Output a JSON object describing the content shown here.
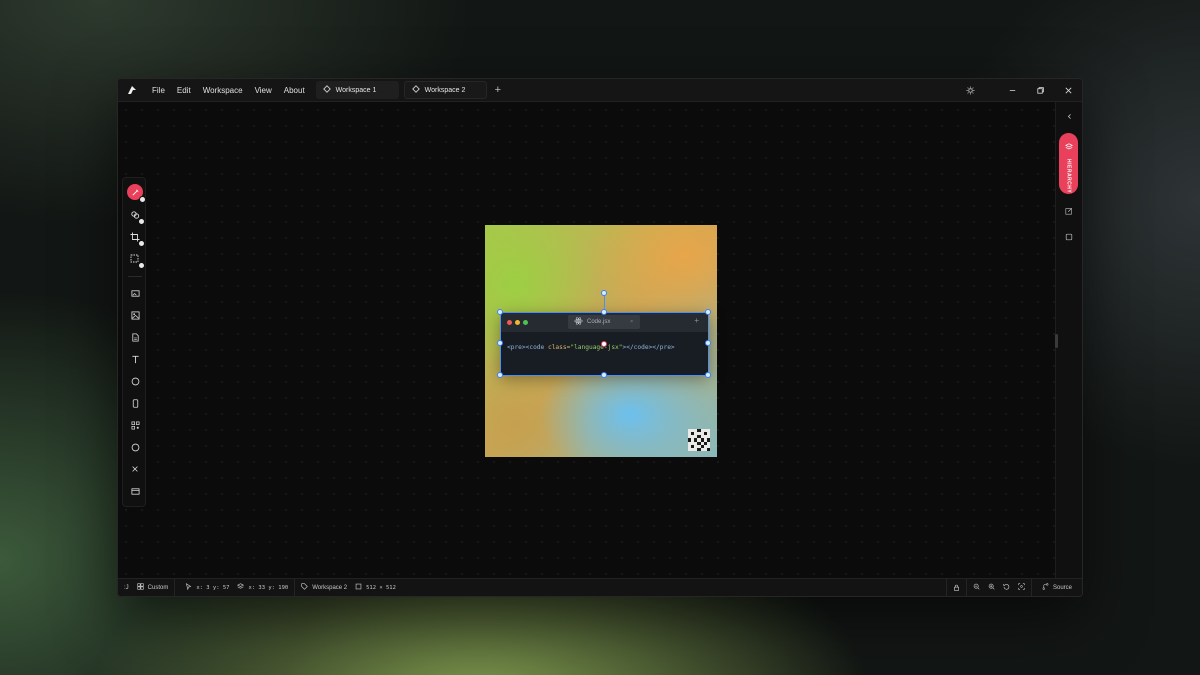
{
  "menu": {
    "items": [
      "File",
      "Edit",
      "Workspace",
      "View",
      "About"
    ]
  },
  "tabs": [
    {
      "label": "Workspace 1"
    },
    {
      "label": "Workspace 2"
    }
  ],
  "tab_add_label": "+",
  "right_panel": {
    "hierarchy_label": "HIERARCHY"
  },
  "code_window": {
    "tab_title": "Code.jsx",
    "tab_close": "×",
    "add": "+",
    "code_parts": {
      "open": "<pre><code ",
      "attr": "class=",
      "value": "\"language-jsx\"",
      "close": "></code></pre>"
    }
  },
  "status_bar": {
    "left_mark": ":J",
    "preset": "Custom",
    "cursor": "x: 3 y: 57",
    "layer_pos": "x: 33 y: 190",
    "workspace": "Workspace 2",
    "size": "512 × 512",
    "source": "Source"
  },
  "colors": {
    "accent": "#e9415b",
    "selection": "#4d8ff5",
    "traffic_red": "#ee5c56",
    "traffic_yellow": "#f3b631",
    "traffic_green": "#4fc256"
  },
  "icons": {
    "toolbar": [
      "brush-icon",
      "layers-icon",
      "crop-icon",
      "resize-icon",
      "image-frame-icon",
      "image-icon",
      "file-icon",
      "text-icon",
      "circle-icon",
      "phone-frame-icon",
      "qr-code-icon",
      "shape-icon",
      "close-icon",
      "window-icon"
    ]
  }
}
